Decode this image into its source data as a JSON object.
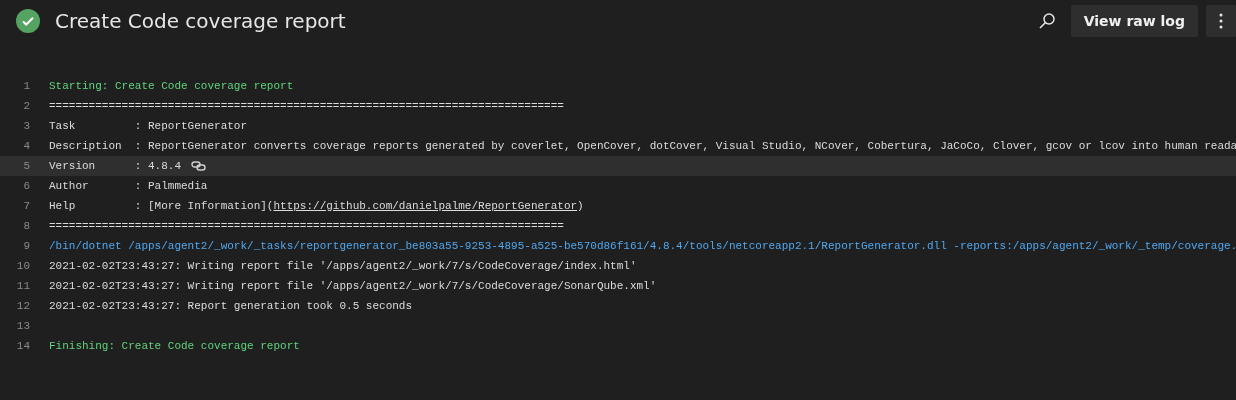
{
  "header": {
    "succeeded": true,
    "title": "Create Code coverage report",
    "buttons": [
      {
        "kind": "search"
      },
      {
        "kind": "text",
        "label": "View raw log"
      },
      {
        "kind": "more"
      }
    ]
  },
  "log": {
    "lines": [
      {
        "number": "1",
        "kind": "section",
        "selected": false,
        "segments": [
          {
            "kind": "text",
            "text": "Starting: Create Code coverage report"
          }
        ]
      },
      {
        "number": "2",
        "kind": "plain",
        "selected": false,
        "segments": [
          {
            "kind": "text",
            "text": "=============================================================================="
          }
        ]
      },
      {
        "number": "3",
        "kind": "plain",
        "selected": false,
        "segments": [
          {
            "kind": "text",
            "text": "Task         : ReportGenerator"
          }
        ]
      },
      {
        "number": "4",
        "kind": "plain",
        "selected": false,
        "segments": [
          {
            "kind": "text",
            "text": "Description  : ReportGenerator converts coverage reports generated by coverlet, OpenCover, dotCover, Visual Studio, NCover, Cobertura, JaCoCo, Clover, gcov or lcov into human reada"
          }
        ]
      },
      {
        "number": "5",
        "kind": "plain",
        "selected": true,
        "link_icon": true,
        "segments": [
          {
            "kind": "text",
            "text": "Version      : 4.8.4"
          }
        ]
      },
      {
        "number": "6",
        "kind": "plain",
        "selected": false,
        "segments": [
          {
            "kind": "text",
            "text": "Author       : Palmmedia"
          }
        ]
      },
      {
        "number": "7",
        "kind": "plain",
        "selected": false,
        "segments": [
          {
            "kind": "text",
            "text": "Help         : [More Information]("
          },
          {
            "kind": "link",
            "text": "https://github.com/danielpalme/ReportGenerator"
          },
          {
            "kind": "text",
            "text": ")"
          }
        ]
      },
      {
        "number": "8",
        "kind": "plain",
        "selected": false,
        "segments": [
          {
            "kind": "text",
            "text": "=============================================================================="
          }
        ]
      },
      {
        "number": "9",
        "kind": "command",
        "selected": false,
        "segments": [
          {
            "kind": "text",
            "text": "/bin/dotnet /apps/agent2/_work/_tasks/reportgenerator_be803a55-9253-4895-a525-be570d86f161/4.8.4/tools/netcoreapp2.1/ReportGenerator.dll -reports:/apps/agent2/_work/_temp/coverage."
          }
        ]
      },
      {
        "number": "10",
        "kind": "plain",
        "selected": false,
        "segments": [
          {
            "kind": "text",
            "text": "2021-02-02T23:43:27: Writing report file '/apps/agent2/_work/7/s/CodeCoverage/index.html'"
          }
        ]
      },
      {
        "number": "11",
        "kind": "plain",
        "selected": false,
        "segments": [
          {
            "kind": "text",
            "text": "2021-02-02T23:43:27: Writing report file '/apps/agent2/_work/7/s/CodeCoverage/SonarQube.xml'"
          }
        ]
      },
      {
        "number": "12",
        "kind": "plain",
        "selected": false,
        "segments": [
          {
            "kind": "text",
            "text": "2021-02-02T23:43:27: Report generation took 0.5 seconds"
          }
        ]
      },
      {
        "number": "13",
        "selected": false
      },
      {
        "number": "14",
        "kind": "section",
        "selected": false,
        "segments": [
          {
            "kind": "text",
            "text": "Finishing: Create Code coverage report"
          }
        ]
      }
    ]
  }
}
